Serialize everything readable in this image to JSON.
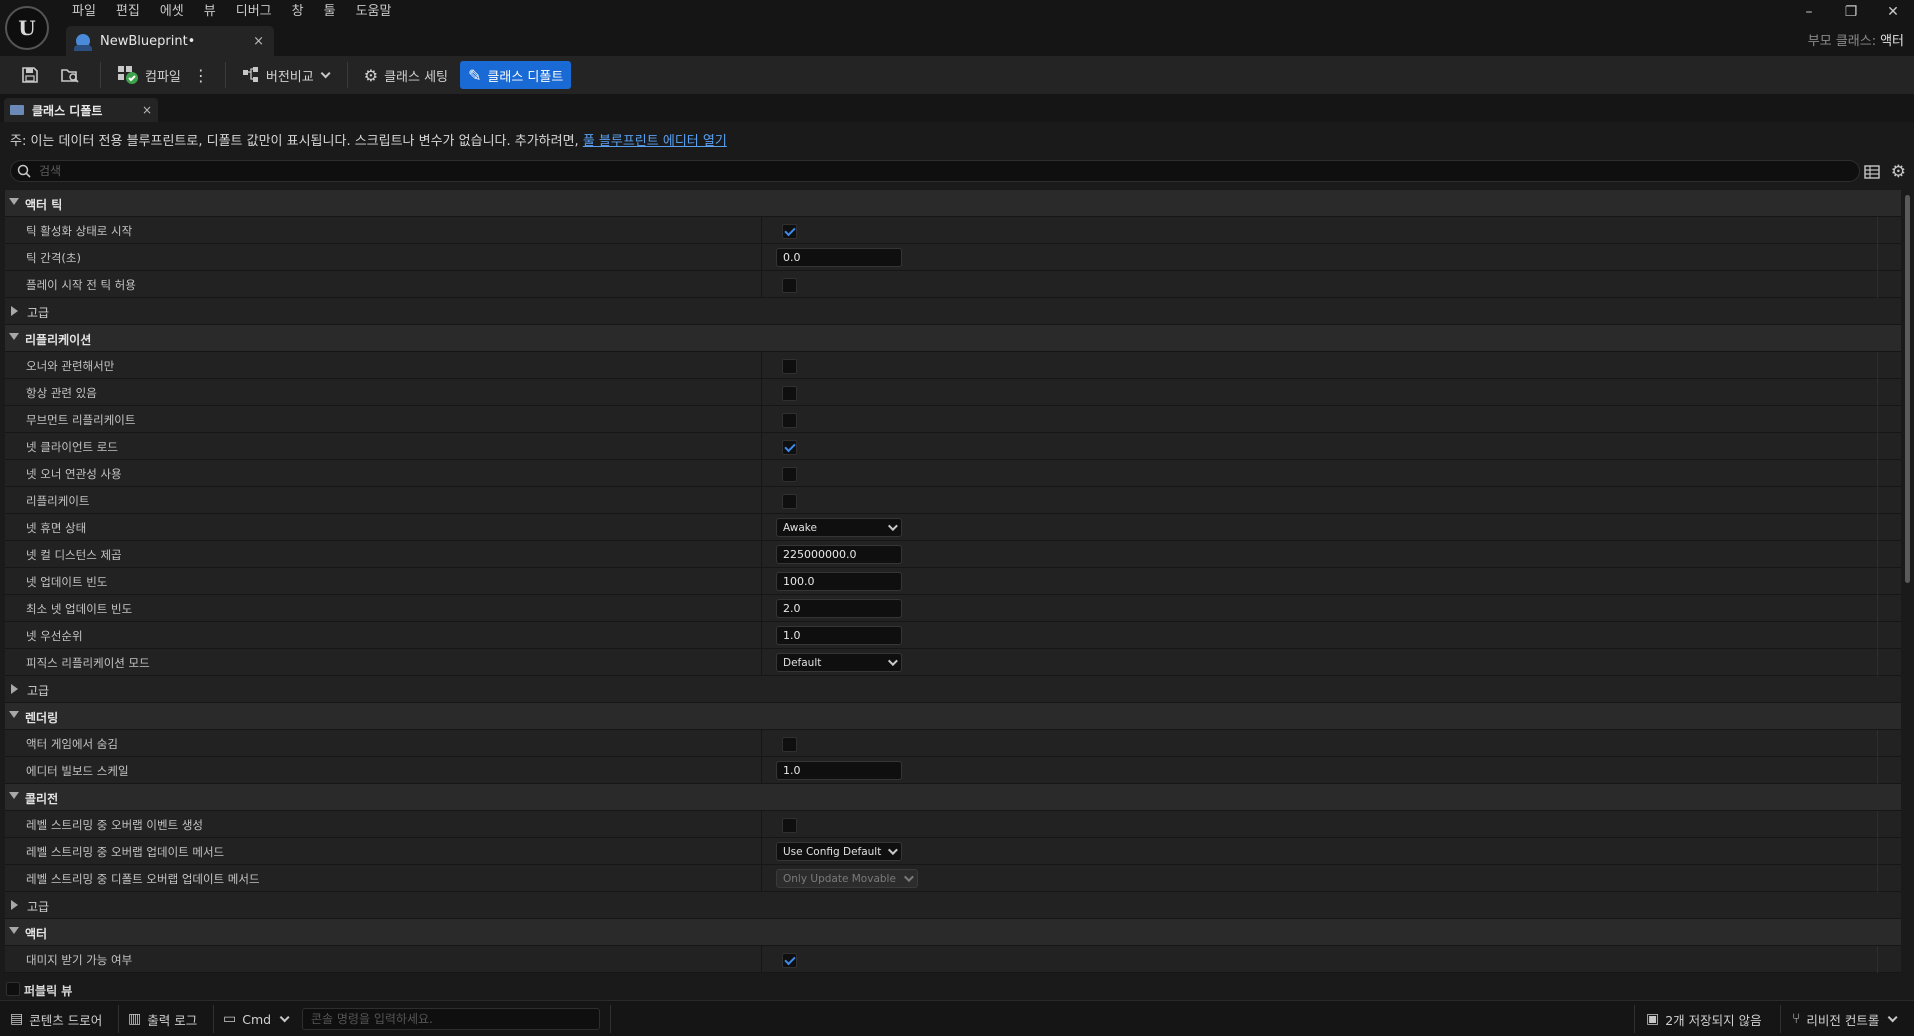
{
  "app": {
    "logo_text": "U",
    "menu": [
      "파일",
      "편집",
      "에셋",
      "뷰",
      "디버그",
      "창",
      "툴",
      "도움말"
    ],
    "asset_tab": {
      "title": "NewBlueprint•",
      "close": "×"
    },
    "parent_class": {
      "label": "부모 클래스:",
      "value": "액터"
    },
    "window_controls": {
      "minimize": "–",
      "restore": "❐",
      "close": "✕"
    }
  },
  "toolbar": {
    "compile_label": "컴파일",
    "diff_label": "버전비교",
    "class_settings_label": "클래스 세팅",
    "class_defaults_label": "클래스 디폴트",
    "active": "class_defaults"
  },
  "panel_tab": {
    "title": "클래스 디폴트",
    "close": "×"
  },
  "details": {
    "notice_text": "주: 이는 데이터 전용 블루프린트로, 디폴트 값만이 표시됩니다. 스크립트나 변수가 없습니다. 추가하려면,",
    "notice_link": "풀 블루프린트 에디터 열기",
    "search_placeholder": "검색",
    "rows": [
      {
        "type": "category",
        "label": "액터 틱"
      },
      {
        "type": "checkbox",
        "label": "틱 활성화 상태로 시작",
        "checked": true
      },
      {
        "type": "text",
        "label": "틱 간격(초)",
        "value": "0.0"
      },
      {
        "type": "checkbox",
        "label": "플레이 시작 전 틱 허용",
        "checked": false
      },
      {
        "type": "collapsed",
        "label": "고급"
      },
      {
        "type": "category",
        "label": "리플리케이션"
      },
      {
        "type": "checkbox",
        "label": "오너와 관련해서만",
        "checked": false
      },
      {
        "type": "checkbox",
        "label": "항상 관련 있음",
        "checked": false
      },
      {
        "type": "checkbox",
        "label": "무브먼트 리플리케이트",
        "checked": false
      },
      {
        "type": "checkbox",
        "label": "넷 클라이언트 로드",
        "checked": true
      },
      {
        "type": "checkbox",
        "label": "넷 오너 연관성 사용",
        "checked": false
      },
      {
        "type": "checkbox",
        "label": "리플리케이트",
        "checked": false
      },
      {
        "type": "dropdown",
        "label": "넷 휴면 상태",
        "value": "Awake"
      },
      {
        "type": "text",
        "label": "넷 컬 디스턴스 제곱",
        "value": "225000000.0"
      },
      {
        "type": "text",
        "label": "넷 업데이트 빈도",
        "value": "100.0"
      },
      {
        "type": "text",
        "label": "최소 넷 업데이트 빈도",
        "value": "2.0"
      },
      {
        "type": "text",
        "label": "넷 우선순위",
        "value": "1.0"
      },
      {
        "type": "dropdown",
        "label": "피직스 리플리케이션 모드",
        "value": "Default"
      },
      {
        "type": "collapsed",
        "label": "고급"
      },
      {
        "type": "category",
        "label": "렌더링"
      },
      {
        "type": "checkbox",
        "label": "액터 게임에서 숨김",
        "checked": false
      },
      {
        "type": "text",
        "label": "에디터 빌보드 스케일",
        "value": "1.0"
      },
      {
        "type": "category",
        "label": "콜리전"
      },
      {
        "type": "checkbox",
        "label": "레벨 스트리밍 중 오버랩 이벤트 생성",
        "checked": false
      },
      {
        "type": "dropdown",
        "label": "레벨 스트리밍 중 오버랩 업데이트 메서드",
        "value": "Use Config Default"
      },
      {
        "type": "dropdown_disabled",
        "label": "레벨 스트리밍 중 디폴트 오버랩 업데이트 메서드",
        "value": "Only Update Movable"
      },
      {
        "type": "collapsed",
        "label": "고급"
      },
      {
        "type": "category",
        "label": "액터"
      },
      {
        "type": "checkbox",
        "label": "대미지 받기 가능 여부",
        "checked": true
      }
    ],
    "public_view_label": "퍼블릭 뷰"
  },
  "statusbar": {
    "content_drawer": "콘텐츠 드로어",
    "output_log": "출력 로그",
    "cmd": "Cmd",
    "console_placeholder": "콘솔 명령을 입력하세요.",
    "unsaved": "2개 저장되지 않음",
    "revision_control": "리비전 컨트롤"
  },
  "colors": {
    "accent": "#1a6ad6",
    "link": "#5aa0f2",
    "check": "#3f8cf0"
  }
}
